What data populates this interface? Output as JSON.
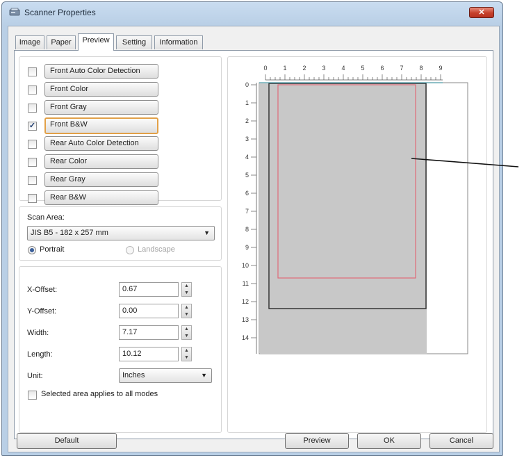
{
  "window": {
    "title": "Scanner Properties",
    "close_glyph": "✕"
  },
  "tabs": [
    {
      "label": "Image"
    },
    {
      "label": "Paper"
    },
    {
      "label": "Preview",
      "active": true
    },
    {
      "label": "Setting"
    },
    {
      "label": "Information"
    }
  ],
  "image_modes": [
    {
      "label": "Front Auto Color Detection",
      "checked": false
    },
    {
      "label": "Front Color",
      "checked": false
    },
    {
      "label": "Front Gray",
      "checked": false
    },
    {
      "label": "Front B&W",
      "checked": true,
      "selected": true
    },
    {
      "label": "Rear Auto Color Detection",
      "checked": false
    },
    {
      "label": "Rear Color",
      "checked": false
    },
    {
      "label": "Rear Gray",
      "checked": false
    },
    {
      "label": "Rear B&W",
      "checked": false
    }
  ],
  "check_glyph": "✓",
  "scan_area": {
    "label": "Scan Area:",
    "value": "JIS B5 - 182 x 257 mm",
    "orientation": {
      "portrait": "Portrait",
      "landscape": "Landscape",
      "selected": "portrait"
    }
  },
  "offsets": {
    "x_offset": {
      "label": "X-Offset:",
      "value": "0.67"
    },
    "y_offset": {
      "label": "Y-Offset:",
      "value": "0.00"
    },
    "width": {
      "label": "Width:",
      "value": "7.17"
    },
    "length": {
      "label": "Length:",
      "value": "10.12"
    },
    "unit": {
      "label": "Unit:",
      "value": "Inches"
    },
    "apply_all": {
      "label": "Selected area applies to all modes",
      "checked": false
    }
  },
  "spin_up": "▲",
  "spin_down": "▼",
  "dropdown_arrow": "▼",
  "preview": {
    "ruler_h": [
      "0",
      "1",
      "2",
      "3",
      "4",
      "5",
      "6",
      "7",
      "8",
      "9"
    ],
    "ruler_v": [
      "0",
      "1",
      "2",
      "3",
      "4",
      "5",
      "6",
      "7",
      "8",
      "9",
      "10",
      "11",
      "12",
      "13",
      "14"
    ],
    "colors": {
      "scan_bg": "#c8c8c8",
      "selection": "#e06a78"
    }
  },
  "buttons": {
    "default": "Default",
    "preview": "Preview",
    "ok": "OK",
    "cancel": "Cancel"
  }
}
